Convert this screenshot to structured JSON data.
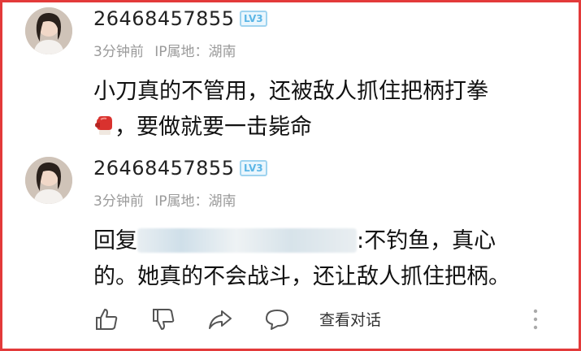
{
  "comments": [
    {
      "username": "26468457855",
      "level": "LV3",
      "time": "3分钟前",
      "ip_label": "IP属地：湖南",
      "text_line1": "小刀真的不管用，还被敌人抓住把柄打拳",
      "text_line2": "，要做就要一击毙命",
      "emoji": "boxing-glove-icon"
    },
    {
      "username": "26468457855",
      "level": "LV3",
      "time": "3分钟前",
      "ip_label": "IP属地：湖南",
      "reply_prefix": "回复",
      "text_line1_suffix": ":不钓鱼，真心",
      "text_line2": "的。她真的不会战斗，还让敌人抓住把柄。"
    }
  ],
  "actions": {
    "view_conversation": "查看对话"
  },
  "colors": {
    "frame": "#e33a3a",
    "badge": "#5cb6e6",
    "meta": "#9a9a9a"
  }
}
